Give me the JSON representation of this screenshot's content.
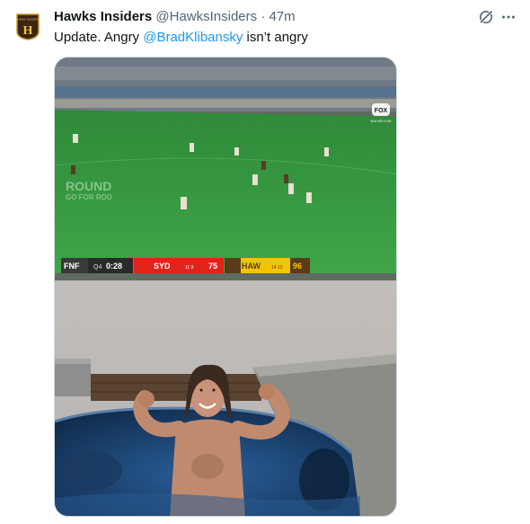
{
  "account": {
    "name": "Hawks Insiders",
    "handle": "@HawksInsiders",
    "separator": "·",
    "time": "47m",
    "avatar_text": "HAWKS INSIDERS",
    "avatar_letter": "H"
  },
  "tweet": {
    "text_before": "Update. Angry ",
    "mention": "@BradKlibansky",
    "text_after": " isn’t angry"
  },
  "actions": {
    "grok_icon": "grok-icon",
    "more_icon": "more-icon"
  },
  "media": {
    "scoreboard": {
      "broadcast": "FNF",
      "quarter": "Q4",
      "clock": "0:28",
      "team1": "SYD",
      "team1_goals_behinds": "11 9",
      "team1_score": "75",
      "team2": "HAW",
      "team2_goals_behinds": "14 12",
      "team2_score": "96"
    },
    "network_logo": "FOX",
    "network_sub": "504 HD LIVE",
    "ground_text1": "ROUND",
    "ground_text2": "GO FOR ROO",
    "colors": {
      "sydney": "#e2231a",
      "hawthorn": "#f5c400",
      "grass": "#3ea043"
    }
  }
}
